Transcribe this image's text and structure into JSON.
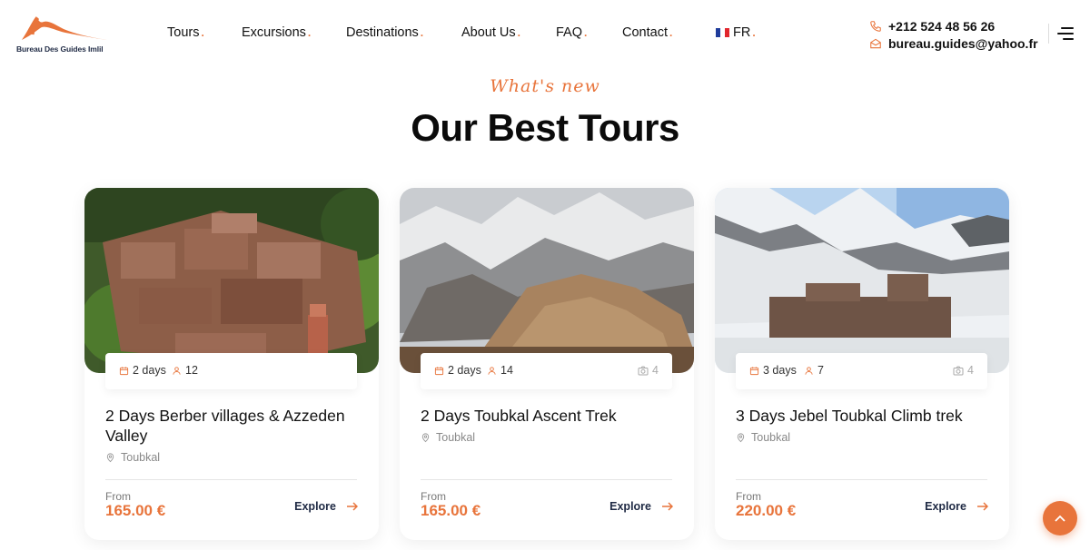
{
  "brand": {
    "name": "Bureau Des Guides Imlil",
    "accent_color": "#e8743b",
    "dark_color": "#1f2a44"
  },
  "nav": {
    "items": [
      {
        "label": "Tours"
      },
      {
        "label": "Excursions"
      },
      {
        "label": "Destinations"
      },
      {
        "label": "About Us"
      },
      {
        "label": "FAQ"
      },
      {
        "label": "Contact"
      },
      {
        "label": "FR",
        "icon": "flag-fr-icon"
      }
    ],
    "dot": "."
  },
  "contact": {
    "phone": "+212 524 48 56 26",
    "email": "bureau.guides@yahoo.fr"
  },
  "section": {
    "eyebrow": "What's new",
    "title": "Our Best Tours"
  },
  "tours": [
    {
      "duration": "2 days",
      "group_size": "12",
      "photos": "",
      "title": "2 Days Berber villages & Azzeden Valley",
      "location": "Toubkal",
      "from_label": "From",
      "price": "165.00 €",
      "cta": "Explore"
    },
    {
      "duration": "2 days",
      "group_size": "14",
      "photos": "4",
      "title": "2 Days Toubkal Ascent Trek",
      "location": "Toubkal",
      "from_label": "From",
      "price": "165.00 €",
      "cta": "Explore"
    },
    {
      "duration": "3 days",
      "group_size": "7",
      "photos": "4",
      "title": "3 Days Jebel Toubkal Climb trek",
      "location": "Toubkal",
      "from_label": "From",
      "price": "220.00 €",
      "cta": "Explore"
    }
  ]
}
